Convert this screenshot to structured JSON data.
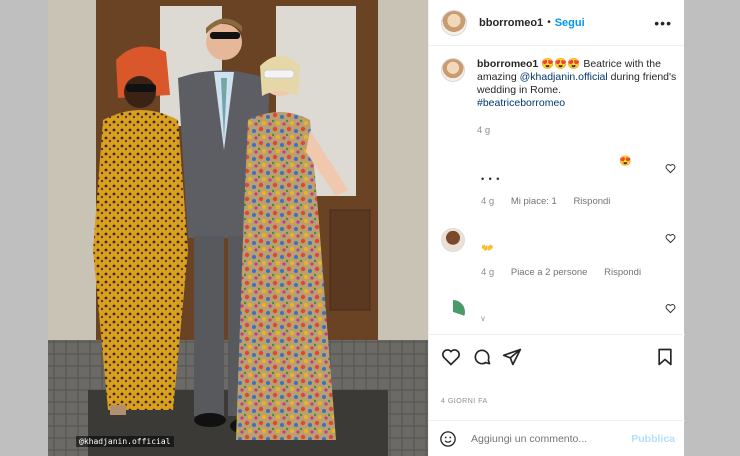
{
  "post": {
    "username": "bborromeo1",
    "follow_label": "Segui",
    "more_label": "•••",
    "caption": {
      "username": "bborromeo1",
      "emojis": "😍😍😍",
      "text_before": "Beatrice with the amazing",
      "mention": "@khadjanin.official",
      "text_after": "during friend's wedding in Rome.",
      "hashtag": "#beatriceborromeo",
      "time": "4 g"
    },
    "photo_tag": "@khadjanin.official",
    "comments": [
      {
        "text": "😍",
        "time": "",
        "likes": "",
        "reply": ""
      },
      {
        "text": "• • •",
        "time": "4 g",
        "likes": "Mi piace: 1",
        "reply": "Rispondi"
      },
      {
        "text": "👐",
        "time": "4 g",
        "likes": "Piace a 2 persone",
        "reply": "Rispondi"
      },
      {
        "text": "v",
        "time": "",
        "likes": "",
        "reply": ""
      }
    ],
    "date": "4 GIORNI FA",
    "comment_placeholder": "Aggiungi un commento...",
    "publish_label": "Pubblica"
  },
  "colors": {
    "accent": "#0095f6",
    "muted": "#8e8e8e",
    "gutter": "#bfbfbf"
  },
  "icons": [
    "like-icon",
    "comment-icon",
    "share-icon",
    "save-icon",
    "emoji-icon",
    "more-icon"
  ]
}
